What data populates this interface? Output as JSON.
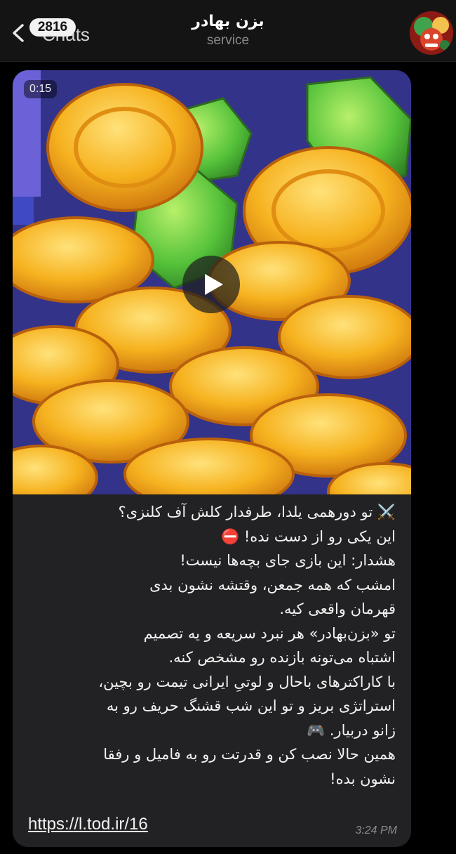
{
  "header": {
    "back_label": "Chats",
    "unread_badge": "2816",
    "title": "بزن بهادر",
    "subtitle": "service"
  },
  "message": {
    "video_duration": "0:15",
    "lines": [
      "⚔️ تو دورهمی یلدا، طرفدار کلش آف کلنزی؟",
      "این یکی رو از دست نده! ⛔",
      "هشدار: این بازی جای بچه‌ها نیست!",
      "امشب که همه جمعن، وقتشه نشون بدی",
      "قهرمان واقعی کیه.",
      "تو «بزن‌بهادر» هر نبرد سریعه و یه تصمیم",
      "اشتباه می‌تونه بازنده رو مشخص کنه.",
      "با کاراکترهای باحال و لوتیِ ایرانی تیمت رو بچین،",
      "استراتژی بریز و تو این شب قشنگ حریف رو به",
      "زانو دربیار. 🎮",
      "همین حالا نصب کن و قدرتت رو به فامیل و رفقا",
      "نشون بده!"
    ],
    "link": "https://l.tod.ir/16",
    "time": "3:24 PM"
  },
  "colors": {
    "header_bg": "#141414",
    "bubble_bg": "#222224",
    "coin": "#f3a91c",
    "gem": "#5cc43c"
  },
  "icons": [
    "back-chevron-icon",
    "play-icon",
    "crossed-swords-icon",
    "no-entry-icon",
    "gamepad-icon"
  ]
}
